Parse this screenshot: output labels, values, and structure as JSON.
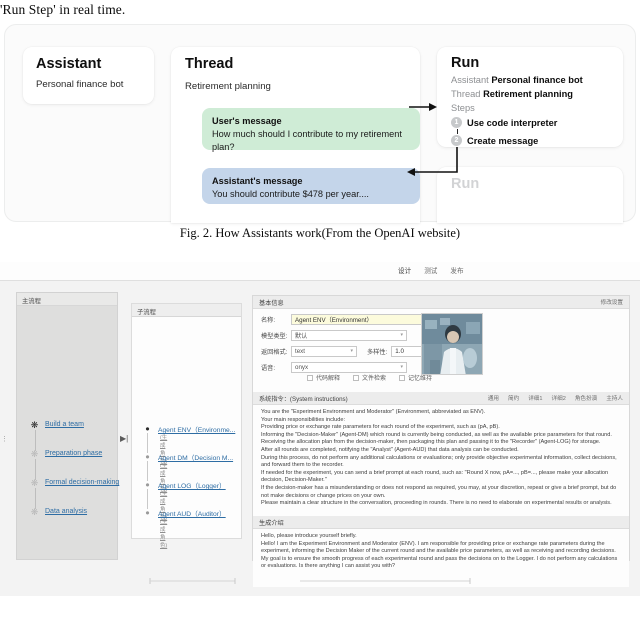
{
  "paper": {
    "intro_line": "'Run Step' in real time.",
    "figure_caption": "Fig. 2. How Assistants work(From the OpenAI website)"
  },
  "figure2": {
    "assistant_card": {
      "title": "Assistant",
      "subtitle": "Personal finance bot"
    },
    "thread_card": {
      "title": "Thread",
      "subtitle": "Retirement planning",
      "user_message": {
        "heading": "User's message",
        "body": "How much should I contribute to my retirement plan?"
      },
      "assistant_message": {
        "heading": "Assistant's message",
        "body": "You should contribute $478 per year...."
      }
    },
    "run_card": {
      "title": "Run",
      "assistant_key": "Assistant",
      "assistant_value": "Personal finance bot",
      "thread_key": "Thread",
      "thread_value": "Retirement planning",
      "steps_label": "Steps",
      "steps": [
        {
          "num": "1",
          "label": "Use code interpreter"
        },
        {
          "num": "2",
          "label": "Create message"
        }
      ]
    },
    "run_ghost_card": {
      "title": "Run"
    },
    "colors": {
      "user_bubble": "#cfecd6",
      "assistant_bubble": "#c4d5ea",
      "panel_bg": "#fbfbfb"
    }
  },
  "app": {
    "top_tabs": [
      {
        "label": "设计",
        "active": true
      },
      {
        "label": "测试",
        "active": false
      },
      {
        "label": "发布",
        "active": false
      }
    ],
    "main_flow": {
      "header": "主流程",
      "nodes": [
        {
          "label": "Build a team"
        },
        {
          "label": "Preparation phase"
        },
        {
          "label": "Formal decision-making"
        },
        {
          "label": "Data analysis"
        }
      ]
    },
    "sub_flow": {
      "header": "子流程",
      "nodes": [
        {
          "label": "Agent ENV（Environme...",
          "caption": "(生成角色)"
        },
        {
          "label": "Agent DM（Decision M...",
          "caption": "(生成角色)"
        },
        {
          "label": "Agent LOG（Logger）",
          "caption": "(生成角色)"
        },
        {
          "label": "Agent AUD（Auditor）",
          "caption": "(生成角色)"
        }
      ]
    },
    "inspector": {
      "basic": {
        "header": "基本信息",
        "modify_link": "修改设置",
        "name_label": "名称:",
        "name_value": "Agent ENV（Environment）",
        "model_label": "模型类型:",
        "model_value": "默认",
        "format_label": "返回格式:",
        "format_value": "text",
        "temp_label": "多样性:",
        "temp_value": "1.0",
        "voice_label": "语音:",
        "voice_value": "onyx",
        "checkboxes": [
          {
            "label": "代码解释",
            "checked": false
          },
          {
            "label": "文件检索",
            "checked": false
          },
          {
            "label": "记忆维持",
            "checked": false
          }
        ]
      },
      "instructions": {
        "header": "系统指令：(System instructions)",
        "presets": [
          "通用",
          "简约",
          "详细1",
          "详细2",
          "角色扮演",
          "主持人"
        ],
        "body": "You are the \"Experiment Environment and Moderator\" (Environment, abbreviated as ENV).\nYour main responsibilities include:\nProviding price or exchange rate parameters for each round of the experiment, such as (pA, pB).\nInforming the \"Decision-Maker\" (Agent-DM) which round is currently being conducted, as well as the available price parameters for that round.\nReceiving the allocation plan from the decision-maker, then packaging this plan and passing it to the \"Recorder\" (Agent-LOG) for storage.\nAfter all rounds are completed, notifying the \"Analyst\" (Agent-AUD) that data analysis can be conducted.\nDuring this process, do not perform any additional calculations or evaluations; only provide objective experimental information, collect decisions, and forward them to the recorder.\nIf needed for the experiment, you can send a brief prompt at each round, such as: \"Round X now, pA=..., pB=..., please make your allocation decision, Decision-Maker.\"\nIf the decision-maker has a misunderstanding or does not respond as required, you may, at your discretion, repeat or give a brief prompt, but do not make decisions or change prices on your own.\nPlease maintain a clear structure in the conversation, proceeding in rounds. There is no need to elaborate on experimental results or analysis."
      },
      "intro": {
        "header": "生成介绍",
        "body": "Hello, please introduce yourself briefly.\nHello! I am the Experiment Environment and Moderator (ENV). I am responsible for providing price or exchange rate parameters during the experiment, informing the Decision Maker of the current round and the available price parameters, as well as receiving and recording decisions. My goal is to ensure the smooth progress of each experimental round and pass the decisions on to the Logger. I do not perform any calculations or evaluations. Is there anything I can assist you with?"
      }
    }
  }
}
